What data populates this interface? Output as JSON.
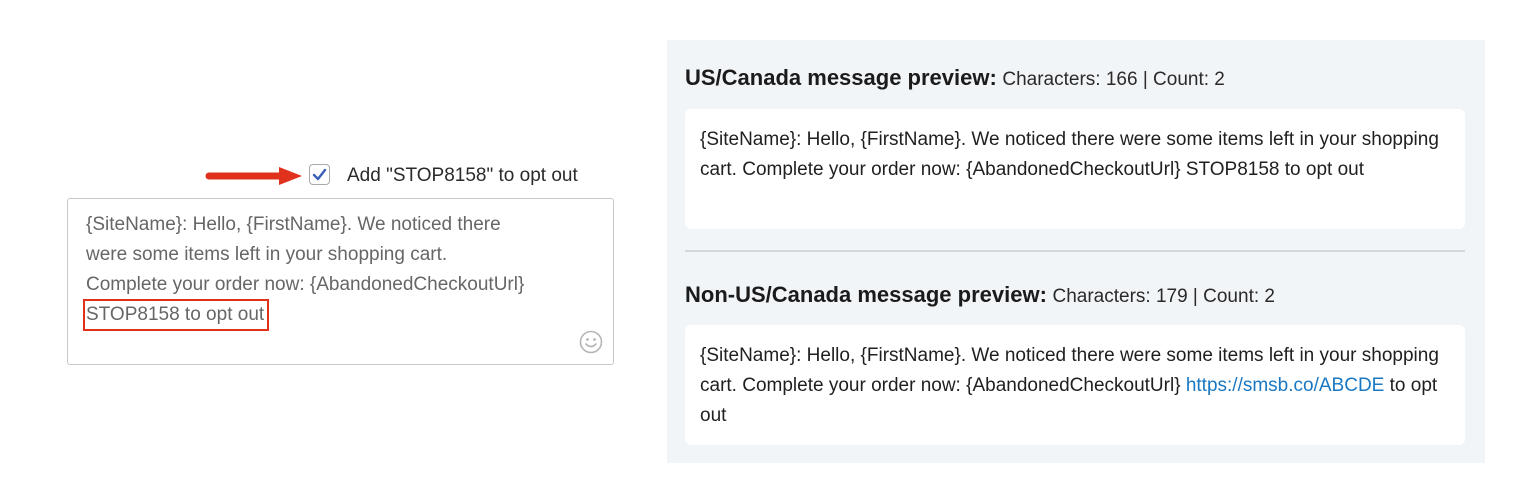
{
  "editor": {
    "optout_checkbox_checked": true,
    "optout_label": "Add \"STOP8158\" to opt out",
    "lines": [
      "{SiteName}: Hello, {FirstName}. We noticed there",
      "were some items left in your shopping cart.",
      "Complete your order now: {AbandonedCheckoutUrl}"
    ],
    "highlighted_line": "STOP8158 to opt out",
    "emoji_icon": "smiley-face-icon"
  },
  "preview": {
    "us": {
      "title": "US/Canada message preview:",
      "stats": "Characters: 166 | Count: 2",
      "message": "{SiteName}: Hello, {FirstName}. We noticed there were some items left in your shopping cart. Complete your order now: {AbandonedCheckoutUrl} STOP8158 to opt out"
    },
    "non_us": {
      "title": "Non-US/Canada message preview:",
      "stats": "Characters: 179 | Count: 2",
      "message_prefix": "{SiteName}: Hello, {FirstName}. We noticed there were some items left in your shopping cart. Complete your order now: {AbandonedCheckoutUrl} ",
      "link_text": "https://smsb.co/ABCDE",
      "message_suffix": " to opt out"
    }
  },
  "colors": {
    "highlight_border": "#e0311d",
    "arrow": "#e0311d",
    "checkmark": "#3a5fb8",
    "link": "#1a78c2",
    "panel_bg": "#f2f5f8"
  }
}
